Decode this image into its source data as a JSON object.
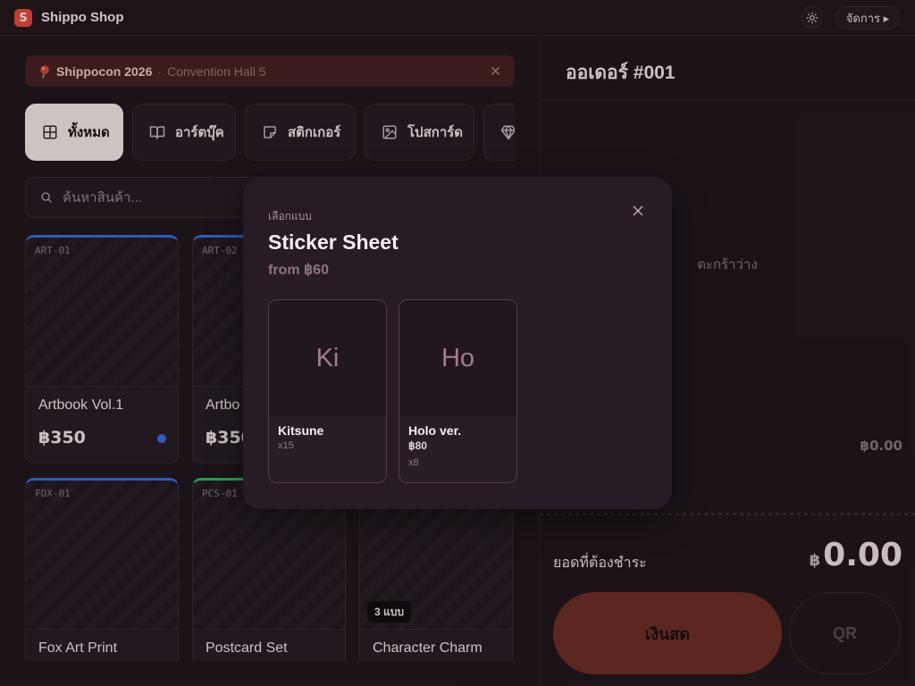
{
  "app": {
    "title": "Shippo Shop",
    "logo_letter": "S"
  },
  "header": {
    "theme_icon": "sun-icon",
    "manage_label": "จัดการ ▸"
  },
  "banner": {
    "icon": "pushpin-icon",
    "event": "Shippocon 2026",
    "separator": "·",
    "venue": "Convention Hall 5",
    "close_icon": "close-icon"
  },
  "categories": [
    {
      "label": "ทั้งหมด",
      "icon": "grid-icon",
      "active": true
    },
    {
      "label": "อาร์ตบุ๊ค",
      "icon": "book-icon",
      "active": false
    },
    {
      "label": "สติกเกอร์",
      "icon": "sticker-icon",
      "active": false
    },
    {
      "label": "โปสการ์ด",
      "icon": "image-icon",
      "active": false
    },
    {
      "icon": "gem-icon",
      "active": false
    }
  ],
  "search": {
    "placeholder": "ค้นหาสินค้า...",
    "icon": "search-icon"
  },
  "products": [
    {
      "code": "ART-01",
      "name": "Artbook Vol.1",
      "price": "฿350",
      "accent": "#3b74ec",
      "dot_color": "#3b74ec"
    },
    {
      "code": "ART-02",
      "name": "Artbo",
      "price": "฿350",
      "accent": "#3b74ec"
    },
    {
      "code": "FOX-01",
      "name": "Fox Art Print",
      "accent": "#3b74ec"
    },
    {
      "code": "PCS-01",
      "name": "Postcard Set",
      "accent": "#2bc871"
    },
    {
      "name": "Character Charm",
      "variants_badge": "3 แบบ"
    }
  ],
  "order": {
    "title": "ออเดอร์ #001",
    "empty_message": "ตะกร้าว่าง",
    "subtotal": "฿0.00",
    "total_label": "ยอดที่ต้องชำระ",
    "total_currency": "฿",
    "total_amount": "0.00",
    "cash_label": "เงินสด",
    "qr_label": "QR"
  },
  "variant_modal": {
    "eyebrow": "เลือกแบบ",
    "title": "Sticker Sheet",
    "price_from": "from ฿60",
    "close_icon": "close-icon",
    "options": [
      {
        "initials": "Ki",
        "name": "Kitsune",
        "stock": "x15"
      },
      {
        "initials": "Ho",
        "name": "Holo ver.",
        "price": "฿80",
        "stock": "x8"
      }
    ]
  },
  "colors": {
    "brand": "#f24f3c",
    "accent_blue": "#3b74ec",
    "accent_green": "#2bc871",
    "cash": "#e0553a",
    "active_tab": "#fff6f0"
  }
}
